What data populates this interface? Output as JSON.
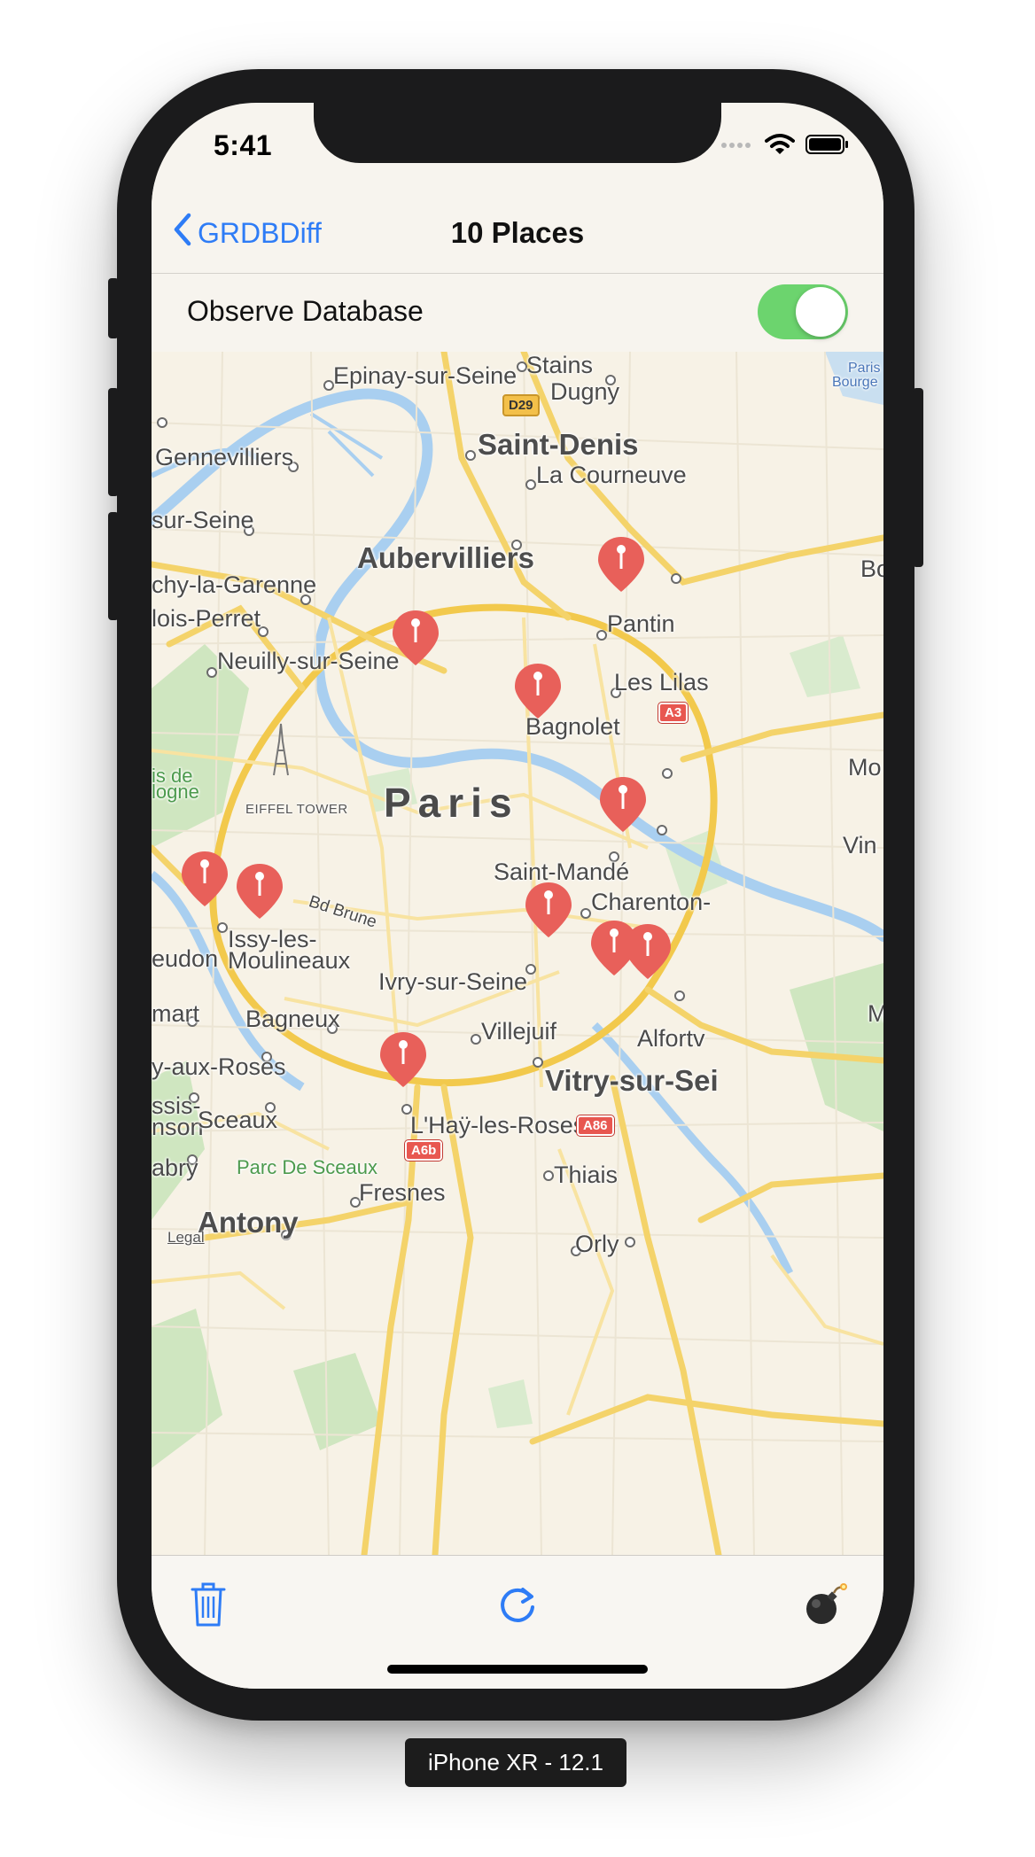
{
  "status_bar": {
    "time": "5:41"
  },
  "nav": {
    "back_label": "GRDBDiff",
    "title": "10 Places"
  },
  "settings": {
    "observe_label": "Observe Database",
    "observe_on": true
  },
  "map": {
    "labels": {
      "epinay": "Epinay-sur-Seine",
      "stains": "Stains",
      "dugny": "Dugny",
      "paris_bourget": "Paris",
      "bourget": "Bourge",
      "d29": "D29",
      "saint_denis": "Saint-Denis",
      "la_courneuve": "La Courneuve",
      "gennevilliers": "Gennevilliers",
      "sur_seine": "sur-Seine",
      "aubervilliers": "Aubervilliers",
      "bo": "Bo",
      "chy_garenne": "chy-la-Garenne",
      "lois_perret": "lois-Perret",
      "pantin": "Pantin",
      "neuilly": "Neuilly-sur-Seine",
      "les_lilas": "Les Lilas",
      "a3": "A3",
      "bagnolet": "Bagnolet",
      "bois_de": "is de",
      "boulogne": "logne",
      "mo": "Mo",
      "eiffel": "EIFFEL TOWER",
      "paris": "Paris",
      "vin": "Vin",
      "saint_mande": "Saint-Mandé",
      "charenton": "Charenton-",
      "bd_brune": "Bd Brune",
      "issy1": "Issy-les-",
      "issy2": "Moulineaux",
      "meudon": "eudon",
      "ivry": "Ivry-sur-Seine",
      "m": "M",
      "clamart": "mart",
      "bagneux": "Bagneux",
      "villejuif": "Villejuif",
      "alfortville": "Alfortv",
      "fontenay": "y-aux-Roses",
      "vitry": "Vitry-sur-Sei",
      "sceaux_left1": "ssis-",
      "sceaux_left2": "nson",
      "sceaux": "Sceaux",
      "lhay": "L'Haÿ-les-Roses",
      "a86": "A86",
      "a6b": "A6b",
      "parc_sceaux": "Parc De Sceaux",
      "chabry": "abry",
      "thiais": "Thiais",
      "fresnes": "Fresnes",
      "antony": "Antony",
      "legal": "Legal",
      "orly": "Orly"
    }
  },
  "toolbar": {
    "delete_icon": "trash-icon",
    "refresh_icon": "refresh-icon",
    "bomb_icon": "bomb-icon"
  },
  "device_label": "iPhone XR - 12.1"
}
